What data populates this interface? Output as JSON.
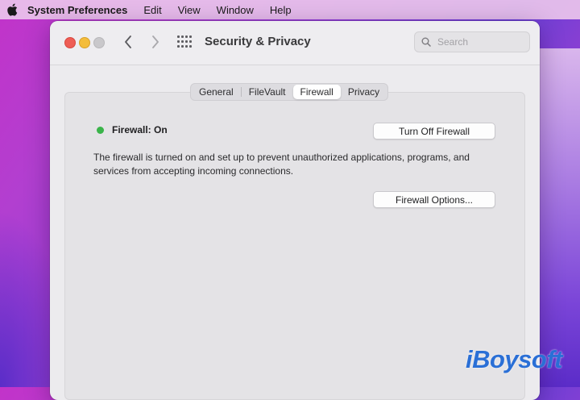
{
  "menubar": {
    "app_name": "System Preferences",
    "items": [
      "Edit",
      "View",
      "Window",
      "Help"
    ]
  },
  "window": {
    "title": "Security & Privacy",
    "search_placeholder": "Search"
  },
  "tabs": [
    {
      "label": "General",
      "active": false
    },
    {
      "label": "FileVault",
      "active": false
    },
    {
      "label": "Firewall",
      "active": true
    },
    {
      "label": "Privacy",
      "active": false
    }
  ],
  "firewall": {
    "status_label": "Firewall: On",
    "status_color": "#3ab44a",
    "toggle_button": "Turn Off Firewall",
    "description": "The firewall is turned on and set up to prevent unauthorized applications, programs, and services from accepting incoming connections.",
    "options_button": "Firewall Options..."
  },
  "watermark": {
    "text": "iBoysoft",
    "color": "#2a6fd6"
  },
  "icons": [
    "apple-icon",
    "back-chevron-icon",
    "forward-chevron-icon",
    "grid-icon",
    "search-icon"
  ]
}
